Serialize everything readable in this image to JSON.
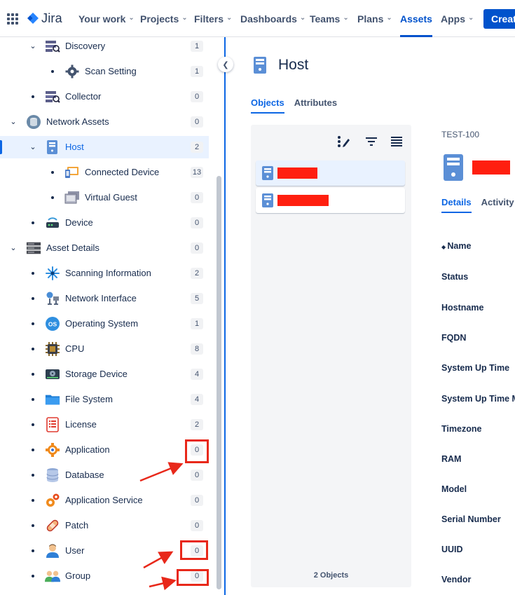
{
  "topbar": {
    "product": "Jira",
    "nav": [
      {
        "label": "Your work",
        "chevron": true
      },
      {
        "label": "Projects",
        "chevron": true
      },
      {
        "label": "Filters",
        "chevron": true
      },
      {
        "label": "Dashboards",
        "chevron": true
      },
      {
        "label": "Teams",
        "chevron": true
      },
      {
        "label": "Plans",
        "chevron": true
      },
      {
        "label": "Assets",
        "chevron": false,
        "active": true
      },
      {
        "label": "Apps",
        "chevron": true
      }
    ],
    "create_label": "Create"
  },
  "sidebar": {
    "items": [
      {
        "label": "Discovery",
        "count": "1",
        "level": 1,
        "toggle": "expanded",
        "icon": "discovery-icon"
      },
      {
        "label": "Scan Setting",
        "count": "1",
        "level": 2,
        "toggle": "leaf",
        "icon": "gear-icon"
      },
      {
        "label": "Collector",
        "count": "0",
        "level": 1,
        "toggle": "leaf",
        "icon": "collector-icon"
      },
      {
        "label": "Network Assets",
        "count": "0",
        "level": 0,
        "toggle": "expanded",
        "icon": "database-icon"
      },
      {
        "label": "Host",
        "count": "2",
        "level": 1,
        "toggle": "expanded",
        "icon": "server-icon",
        "selected": true
      },
      {
        "label": "Connected Device",
        "count": "13",
        "level": 2,
        "toggle": "leaf",
        "icon": "devices-icon"
      },
      {
        "label": "Virtual Guest",
        "count": "0",
        "level": 2,
        "toggle": "leaf",
        "icon": "virtual-guest-icon"
      },
      {
        "label": "Device",
        "count": "0",
        "level": 1,
        "toggle": "leaf",
        "icon": "router-icon"
      },
      {
        "label": "Asset Details",
        "count": "0",
        "level": 0,
        "toggle": "expanded",
        "icon": "rack-icon"
      },
      {
        "label": "Scanning Information",
        "count": "2",
        "level": 1,
        "toggle": "leaf",
        "icon": "sparkle-icon"
      },
      {
        "label": "Network Interface",
        "count": "5",
        "level": 1,
        "toggle": "leaf",
        "icon": "network-icon"
      },
      {
        "label": "Operating System",
        "count": "1",
        "level": 1,
        "toggle": "leaf",
        "icon": "os-icon"
      },
      {
        "label": "CPU",
        "count": "8",
        "level": 1,
        "toggle": "leaf",
        "icon": "cpu-icon"
      },
      {
        "label": "Storage Device",
        "count": "4",
        "level": 1,
        "toggle": "leaf",
        "icon": "disk-icon"
      },
      {
        "label": "File System",
        "count": "4",
        "level": 1,
        "toggle": "leaf",
        "icon": "folder-icon"
      },
      {
        "label": "License",
        "count": "2",
        "level": 1,
        "toggle": "leaf",
        "icon": "license-icon"
      },
      {
        "label": "Application",
        "count": "0",
        "level": 1,
        "toggle": "leaf",
        "icon": "application-icon"
      },
      {
        "label": "Database",
        "count": "0",
        "level": 1,
        "toggle": "leaf",
        "icon": "database-stack-icon"
      },
      {
        "label": "Application Service",
        "count": "0",
        "level": 1,
        "toggle": "leaf",
        "icon": "app-service-icon"
      },
      {
        "label": "Patch",
        "count": "0",
        "level": 1,
        "toggle": "leaf",
        "icon": "bandage-icon"
      },
      {
        "label": "User",
        "count": "0",
        "level": 1,
        "toggle": "leaf",
        "icon": "user-icon"
      },
      {
        "label": "Group",
        "count": "0",
        "level": 1,
        "toggle": "leaf",
        "icon": "group-icon"
      }
    ]
  },
  "main": {
    "title": "Host",
    "tabs": [
      {
        "label": "Objects",
        "active": true
      },
      {
        "label": "Attributes",
        "active": false
      }
    ],
    "objects_footer": "2 Objects",
    "detail": {
      "object_key": "TEST-100",
      "tabs": [
        {
          "label": "Details",
          "active": true
        },
        {
          "label": "Activity",
          "active": false
        }
      ],
      "attributes": [
        "Name",
        "Status",
        "Hostname",
        "FQDN",
        "System Up Time",
        "System Up Time M",
        "Timezone",
        "RAM",
        "Model",
        "Serial Number",
        "UUID",
        "Vendor"
      ]
    }
  },
  "colors": {
    "accent": "#0c66e4",
    "annotation": "#e8281a",
    "redaction": "#ff1f0f"
  }
}
